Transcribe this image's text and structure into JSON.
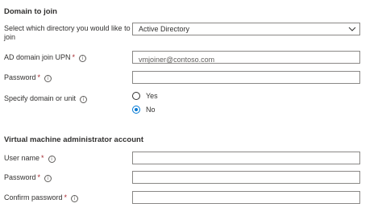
{
  "domain_section": {
    "title": "Domain to join",
    "directory": {
      "label_line1": "Select which directory you would like to",
      "label_line2": "join",
      "selected": "Active Directory"
    },
    "upn": {
      "label": "AD domain join UPN",
      "required_mark": "*",
      "info_glyph": "i",
      "placeholder": "vmjoiner@contoso.com",
      "value": ""
    },
    "password": {
      "label": "Password",
      "required_mark": "*",
      "info_glyph": "i",
      "value": ""
    },
    "specify_ou": {
      "label": "Specify domain or unit",
      "info_glyph": "i",
      "options": [
        {
          "label": "Yes",
          "checked": false
        },
        {
          "label": "No",
          "checked": true
        }
      ]
    }
  },
  "admin_section": {
    "title": "Virtual machine administrator account",
    "username": {
      "label": "User name",
      "required_mark": "*",
      "info_glyph": "i",
      "value": ""
    },
    "password": {
      "label": "Password",
      "required_mark": "*",
      "info_glyph": "i",
      "value": ""
    },
    "confirm_password": {
      "label": "Confirm password",
      "required_mark": "*",
      "info_glyph": "i",
      "value": ""
    }
  },
  "icons": {
    "select_chevron": "chevron-down-icon",
    "info": "info-icon"
  },
  "colors": {
    "accent": "#0078d4",
    "required": "#a4262c",
    "border": "#8a8886",
    "text": "#323130"
  }
}
